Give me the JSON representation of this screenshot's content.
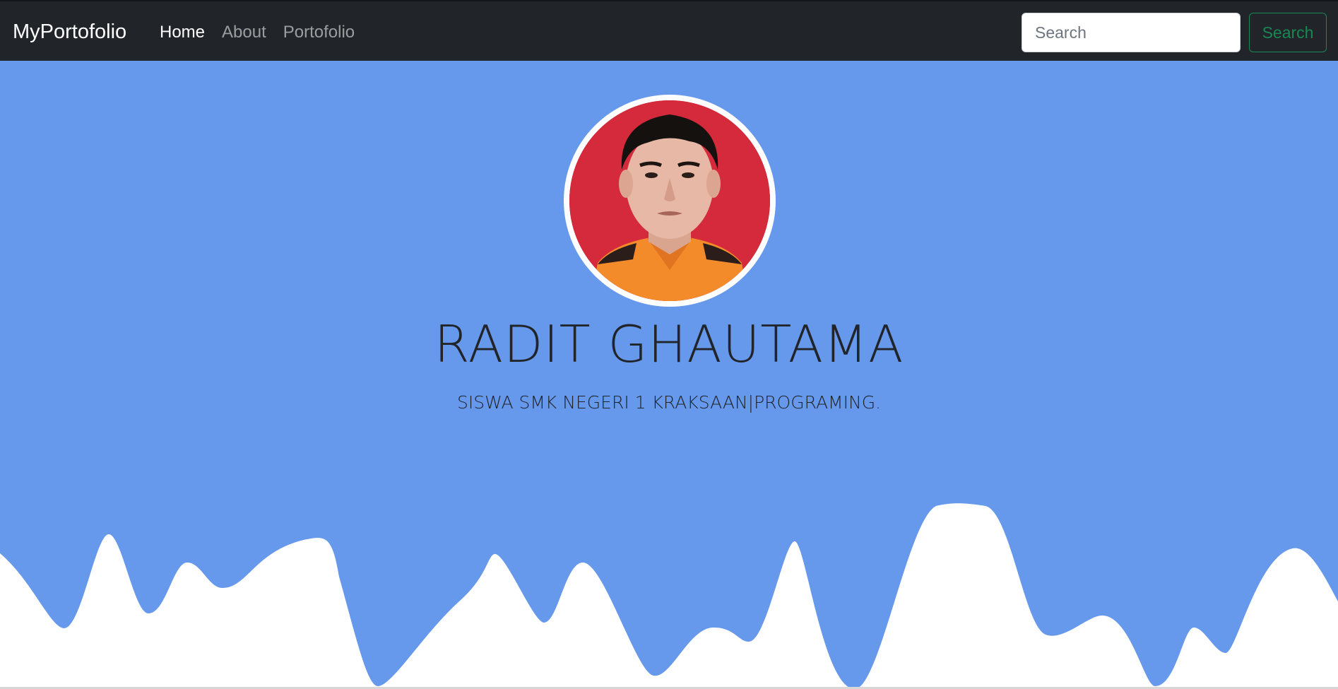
{
  "navbar": {
    "brand": "MyPortofolio",
    "links": [
      {
        "label": "Home",
        "active": true
      },
      {
        "label": "About",
        "active": false
      },
      {
        "label": "Portofolio",
        "active": false
      }
    ],
    "search": {
      "placeholder": "Search",
      "button_label": "Search"
    }
  },
  "hero": {
    "name": "RADIT GHAUTAMA",
    "tagline": "SISWA SMK NEGERI 1 KRAKSAAN|PROGRAMING."
  },
  "colors": {
    "navbar_bg": "#212529",
    "hero_bg": "#6698ec",
    "search_button": "#198754",
    "avatar_bg": "#d42a3c",
    "shirt": "#f38b2b"
  },
  "icons": {
    "avatar": "profile-photo"
  }
}
